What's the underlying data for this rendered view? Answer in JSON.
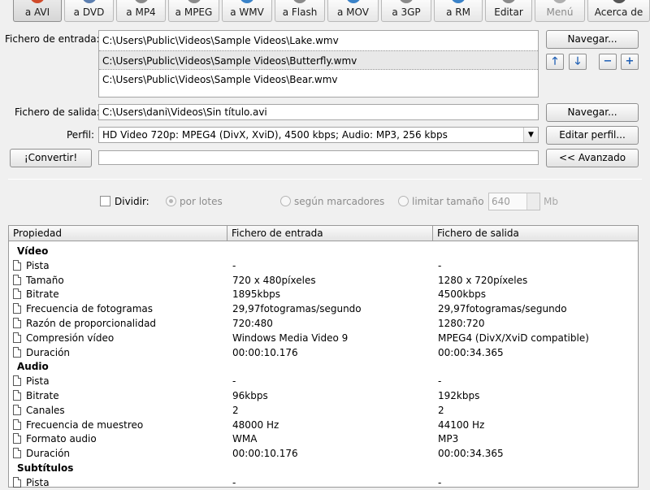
{
  "toolbar": {
    "buttons": [
      {
        "label": "a AVI",
        "icon": "avi-icon",
        "active": true
      },
      {
        "label": "a DVD",
        "icon": "dvd-icon"
      },
      {
        "label": "a MP4",
        "icon": "mp4-icon"
      },
      {
        "label": "a MPEG",
        "icon": "mpeg-icon"
      },
      {
        "label": "a WMV",
        "icon": "wmv-icon"
      },
      {
        "label": "a Flash",
        "icon": "flash-icon"
      },
      {
        "label": "a MOV",
        "icon": "mov-icon"
      },
      {
        "label": "a 3GP",
        "icon": "3gp-icon"
      },
      {
        "label": "a RM",
        "icon": "rm-icon"
      },
      {
        "label": "Editar",
        "icon": "edit-icon"
      },
      {
        "label": "Menú",
        "icon": "menu-icon",
        "disabled": true
      },
      {
        "label": "Acerca de",
        "icon": "about-icon"
      }
    ]
  },
  "input": {
    "label": "Fichero de entrada:",
    "files": [
      "C:\\Users\\Public\\Videos\\Sample Videos\\Lake.wmv",
      "C:\\Users\\Public\\Videos\\Sample Videos\\Butterfly.wmv",
      "C:\\Users\\Public\\Videos\\Sample Videos\\Bear.wmv"
    ],
    "selected_index": 1,
    "browse_label": "Navegar...",
    "move_up_glyph": "🡑",
    "move_down_glyph": "🡓",
    "remove_glyph": "−",
    "add_glyph": "+"
  },
  "output": {
    "label": "Fichero de salida:",
    "value": "C:\\Users\\dani\\Videos\\Sin título.avi",
    "browse_label": "Navegar..."
  },
  "profile": {
    "label": "Perfil:",
    "value": "HD Video 720p: MPEG4 (DivX, XviD), 4500 kbps; Audio: MP3, 256 kbps",
    "edit_label": "Editar perfil..."
  },
  "convert": {
    "label": "¡Convertir!",
    "progress": 0,
    "advanced_label": "<< Avanzado"
  },
  "split": {
    "label": "Dividir:",
    "checked": false,
    "by_batch": "por lotes",
    "by_markers": "según marcadores",
    "limit_size": "limitar tamaño",
    "size_value": "640",
    "size_unit": "Mb"
  },
  "table": {
    "headers": [
      "Propiedad",
      "Fichero de entrada",
      "Fichero de salida"
    ],
    "rows": [
      {
        "type": "section",
        "prop": "Vídeo"
      },
      {
        "prop": "Pista",
        "in": "-",
        "out": "-"
      },
      {
        "prop": "Tamaño",
        "in": "720 x 480píxeles",
        "out": "1280 x 720píxeles"
      },
      {
        "prop": "Bitrate",
        "in": "1895kbps",
        "out": "4500kbps"
      },
      {
        "prop": "Frecuencia de fotogramas",
        "in": "29,97fotogramas/segundo",
        "out": "29,97fotogramas/segundo"
      },
      {
        "prop": "Razón de proporcionalidad",
        "in": "720:480",
        "out": "1280:720"
      },
      {
        "prop": "Compresión vídeo",
        "in": "Windows Media Video 9",
        "out": "MPEG4 (DivX/XviD compatible)"
      },
      {
        "prop": "Duración",
        "in": "00:00:10.176",
        "out": "00:00:34.365"
      },
      {
        "type": "section",
        "prop": "Audio"
      },
      {
        "prop": "Pista",
        "in": "-",
        "out": "-"
      },
      {
        "prop": "Bitrate",
        "in": "96kbps",
        "out": "192kbps"
      },
      {
        "prop": "Canales",
        "in": "2",
        "out": "2"
      },
      {
        "prop": "Frecuencia de muestreo",
        "in": "48000 Hz",
        "out": "44100 Hz"
      },
      {
        "prop": "Formato audio",
        "in": "WMA",
        "out": "MP3"
      },
      {
        "prop": "Duración",
        "in": "00:00:10.176",
        "out": "00:00:34.365"
      },
      {
        "type": "section",
        "prop": "Subtítulos"
      },
      {
        "prop": "Pista",
        "in": "-",
        "out": "-"
      }
    ]
  },
  "colors": {
    "toolbar_icons": [
      "#d04a2a",
      "#5c7fb0",
      "#8a8a8a",
      "#8a8a8a",
      "#3a82c8",
      "#8a8a8a",
      "#3a82c8",
      "#8a8a8a",
      "#3a82c8",
      "#8a8a8a",
      "#b0b0b0",
      "#555555"
    ],
    "accent_arrows": "#1f5fb4"
  }
}
